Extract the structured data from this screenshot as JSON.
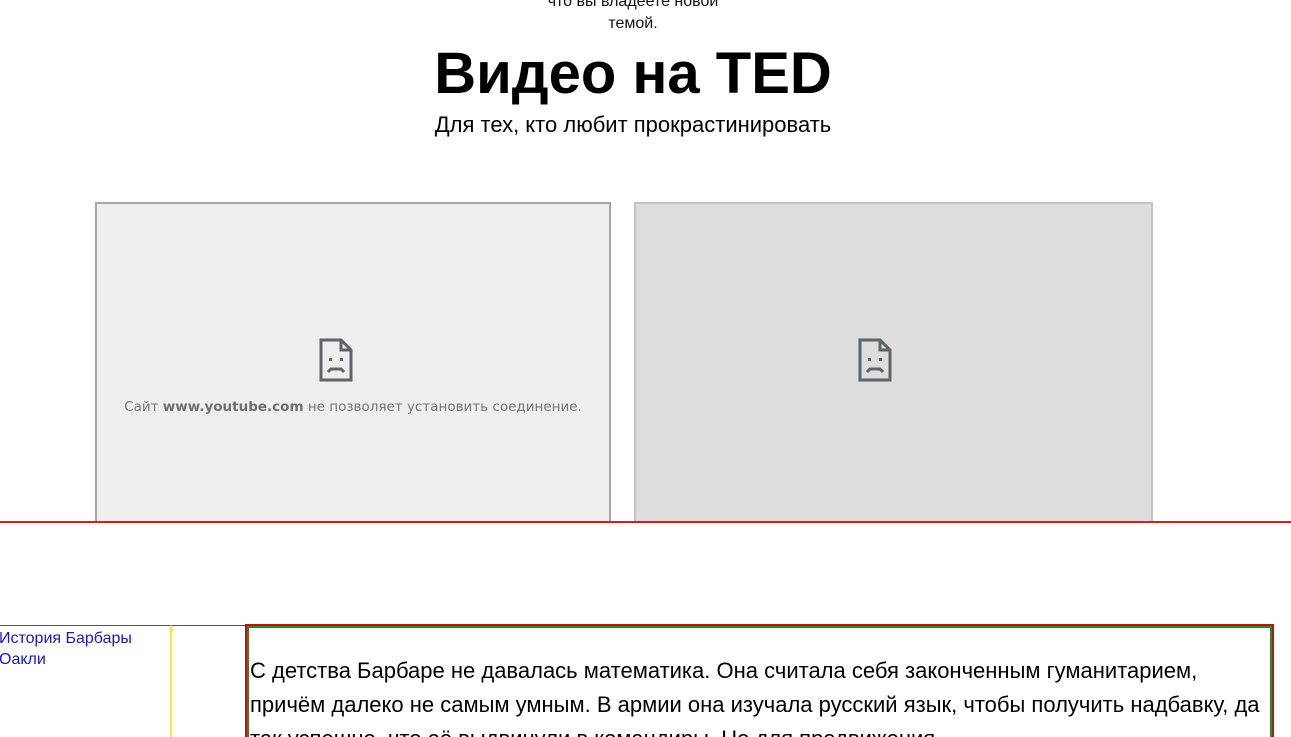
{
  "top_caption": {
    "line1": "что вы владеете новой",
    "line2": "темой."
  },
  "hero": {
    "title": "Видео на TED",
    "subtitle": "Для тех, кто любит прокрастинировать"
  },
  "videos": [
    {
      "error_prefix": "Сайт",
      "error_host": "www.youtube.com",
      "error_suffix": "не позволяет установить соединение.",
      "icon": "sad-document-icon"
    },
    {
      "icon": "sad-document-icon"
    }
  ],
  "sidebar": {
    "link_label": "История Барбары Оакли"
  },
  "article": {
    "text": "С детства Барбаре не давалась математика. Она считала себя законченным гуманитарием, причём далеко не самым умным. В армии она изучала русский язык, чтобы получить надбавку, да так успешно, что её выдвинули в командиры. Но для продвижения"
  },
  "colors": {
    "separator": "#e01818",
    "sidebar_border": "#f2ec2b",
    "article_outer_border": "#c01010",
    "article_inner_border": "#2a8a20",
    "link": "#1a1ab4"
  }
}
